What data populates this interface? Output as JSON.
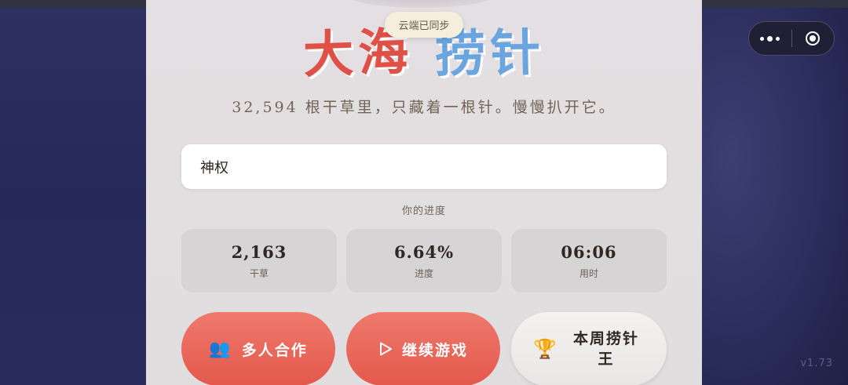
{
  "capsule": {
    "more_icon": "more-dots-icon",
    "close_icon": "target-close-icon"
  },
  "sync_badge": "云端已同步",
  "title": {
    "part1": "大海",
    "part2": "捞针",
    "colors": {
      "part1": "#df5146",
      "part2": "#6aa5e0"
    }
  },
  "subtitle": "32,594 根干草里，只藏着一根针。慢慢扒开它。",
  "search_input": {
    "value": "神权",
    "placeholder": ""
  },
  "progress_label": "你的进度",
  "stats": [
    {
      "value": "2,163",
      "label": "干草"
    },
    {
      "value": "6.64%",
      "label": "进度"
    },
    {
      "value": "06:06",
      "label": "用时"
    }
  ],
  "buttons": {
    "coop": {
      "label": "多人合作",
      "icon": "people-icon"
    },
    "continue": {
      "label": "继续游戏",
      "icon": "play-icon"
    },
    "rank": {
      "label": "本周捞针王",
      "icon": "trophy-icon"
    }
  },
  "version": "v1.73",
  "accent_color": "#e4584c"
}
